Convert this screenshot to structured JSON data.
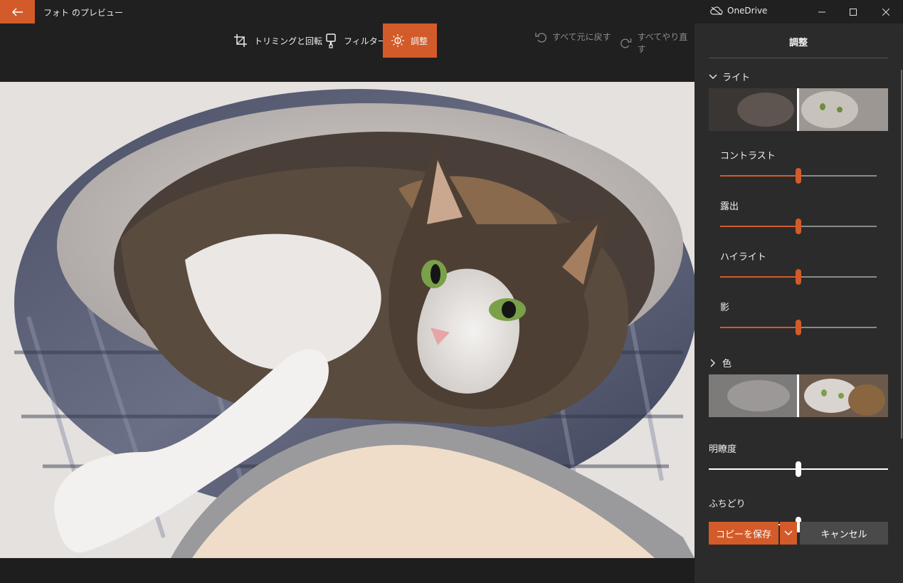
{
  "titlebar": {
    "app_title": "フォト のプレビュー",
    "onedrive_label": "OneDrive"
  },
  "toolbar": {
    "crop_label": "トリミングと回転",
    "filter_label": "フィルター",
    "adjust_label": "調整",
    "undo_label": "すべて元に戻す",
    "redo_label": "すべてやり直す"
  },
  "panel": {
    "title": "調整",
    "light": {
      "label": "ライト",
      "sliders": [
        {
          "label": "コントラスト",
          "value": 0.5
        },
        {
          "label": "露出",
          "value": 0.5
        },
        {
          "label": "ハイライト",
          "value": 0.5
        },
        {
          "label": "影",
          "value": 0.5
        }
      ]
    },
    "color": {
      "label": "色"
    },
    "clarity": {
      "label": "明瞭度",
      "value": 0.5
    },
    "vignette": {
      "label": "ふちどり",
      "value": 0.5
    }
  },
  "buttons": {
    "save_copy": "コピーを保存",
    "cancel": "キャンセル"
  },
  "colors": {
    "accent": "#d35b29",
    "panel_bg": "#2b2b2b",
    "toolbar_bg": "#202020"
  }
}
